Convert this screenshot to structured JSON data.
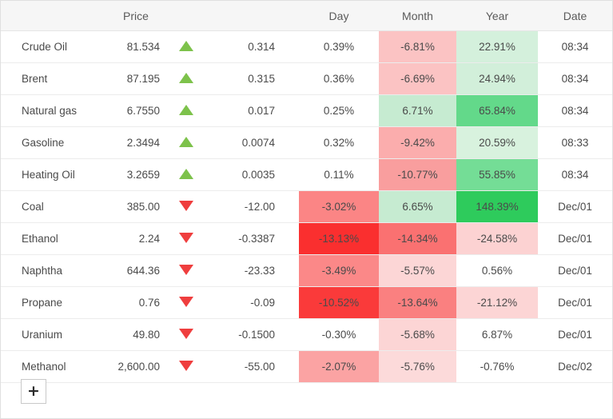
{
  "table": {
    "columns": [
      {
        "key": "name",
        "label": ""
      },
      {
        "key": "price",
        "label": "Price"
      },
      {
        "key": "arrow",
        "label": ""
      },
      {
        "key": "change",
        "label": ""
      },
      {
        "key": "day",
        "label": "Day"
      },
      {
        "key": "month",
        "label": "Month"
      },
      {
        "key": "year",
        "label": "Year"
      },
      {
        "key": "date",
        "label": "Date"
      }
    ],
    "rows": [
      {
        "name": "Crude Oil",
        "price": "81.534",
        "direction": "up",
        "arrow_icon": "triangle-up-icon",
        "change": "0.314",
        "day": "0.39%",
        "month": "-6.81%",
        "year": "22.91%",
        "date": "08:34",
        "day_bg": "#ffffff",
        "month_bg": "#fbc3c3",
        "year_bg": "#d4f0dc"
      },
      {
        "name": "Brent",
        "price": "87.195",
        "direction": "up",
        "arrow_icon": "triangle-up-icon",
        "change": "0.315",
        "day": "0.36%",
        "month": "-6.69%",
        "year": "24.94%",
        "date": "08:34",
        "day_bg": "#ffffff",
        "month_bg": "#fbc3c3",
        "year_bg": "#d2efda"
      },
      {
        "name": "Natural gas",
        "price": "6.7550",
        "direction": "up",
        "arrow_icon": "triangle-up-icon",
        "change": "0.017",
        "day": "0.25%",
        "month": "6.71%",
        "year": "65.84%",
        "date": "08:34",
        "day_bg": "#ffffff",
        "month_bg": "#c6ebd1",
        "year_bg": "#63d98a"
      },
      {
        "name": "Gasoline",
        "price": "2.3494",
        "direction": "up",
        "arrow_icon": "triangle-up-icon",
        "change": "0.0074",
        "day": "0.32%",
        "month": "-9.42%",
        "year": "20.59%",
        "date": "08:33",
        "day_bg": "#ffffff",
        "month_bg": "#fbadad",
        "year_bg": "#d8f2de"
      },
      {
        "name": "Heating Oil",
        "price": "3.2659",
        "direction": "up",
        "arrow_icon": "triangle-up-icon",
        "change": "0.0035",
        "day": "0.11%",
        "month": "-10.77%",
        "year": "55.85%",
        "date": "08:34",
        "day_bg": "#ffffff",
        "month_bg": "#f99e9e",
        "year_bg": "#74dd96"
      },
      {
        "name": "Coal",
        "price": "385.00",
        "direction": "down",
        "arrow_icon": "triangle-down-icon",
        "change": "-12.00",
        "day": "-3.02%",
        "month": "6.65%",
        "year": "148.39%",
        "date": "Dec/01",
        "day_bg": "#fb8585",
        "month_bg": "#c6ebd1",
        "year_bg": "#2ecb5c"
      },
      {
        "name": "Ethanol",
        "price": "2.24",
        "direction": "down",
        "arrow_icon": "triangle-down-icon",
        "change": "-0.3387",
        "day": "-13.13%",
        "month": "-14.34%",
        "year": "-24.58%",
        "date": "Dec/01",
        "day_bg": "#fa2f2f",
        "month_bg": "#fa7171",
        "year_bg": "#fcd2d2"
      },
      {
        "name": "Naphtha",
        "price": "644.36",
        "direction": "down",
        "arrow_icon": "triangle-down-icon",
        "change": "-23.33",
        "day": "-3.49%",
        "month": "-5.57%",
        "year": "0.56%",
        "date": "Dec/01",
        "day_bg": "#fb8888",
        "month_bg": "#fcd6d6",
        "year_bg": "#ffffff"
      },
      {
        "name": "Propane",
        "price": "0.76",
        "direction": "down",
        "arrow_icon": "triangle-down-icon",
        "change": "-0.09",
        "day": "-10.52%",
        "month": "-13.64%",
        "year": "-21.12%",
        "date": "Dec/01",
        "day_bg": "#fa3a3a",
        "month_bg": "#fa8080",
        "year_bg": "#fcd5d5"
      },
      {
        "name": "Uranium",
        "price": "49.80",
        "direction": "down",
        "arrow_icon": "triangle-down-icon",
        "change": "-0.1500",
        "day": "-0.30%",
        "month": "-5.68%",
        "year": "6.87%",
        "date": "Dec/01",
        "day_bg": "#ffffff",
        "month_bg": "#fcd5d5",
        "year_bg": "#ffffff"
      },
      {
        "name": "Methanol",
        "price": "2,600.00",
        "direction": "down",
        "arrow_icon": "triangle-down-icon",
        "change": "-55.00",
        "day": "-2.07%",
        "month": "-5.76%",
        "year": "-0.76%",
        "date": "Dec/02",
        "day_bg": "#fba3a3",
        "month_bg": "#fcdada",
        "year_bg": "#ffffff"
      }
    ]
  },
  "footer": {
    "add_button_icon": "plus-icon",
    "add_button_label": "+"
  },
  "colors": {
    "positive_text": "#2f8b4f",
    "neutral_text": "#4a4a4a",
    "up_arrow": "#7dc24b",
    "down_arrow": "#ef3e3e",
    "header_bg": "#f6f6f6",
    "row_border": "#ececec"
  }
}
